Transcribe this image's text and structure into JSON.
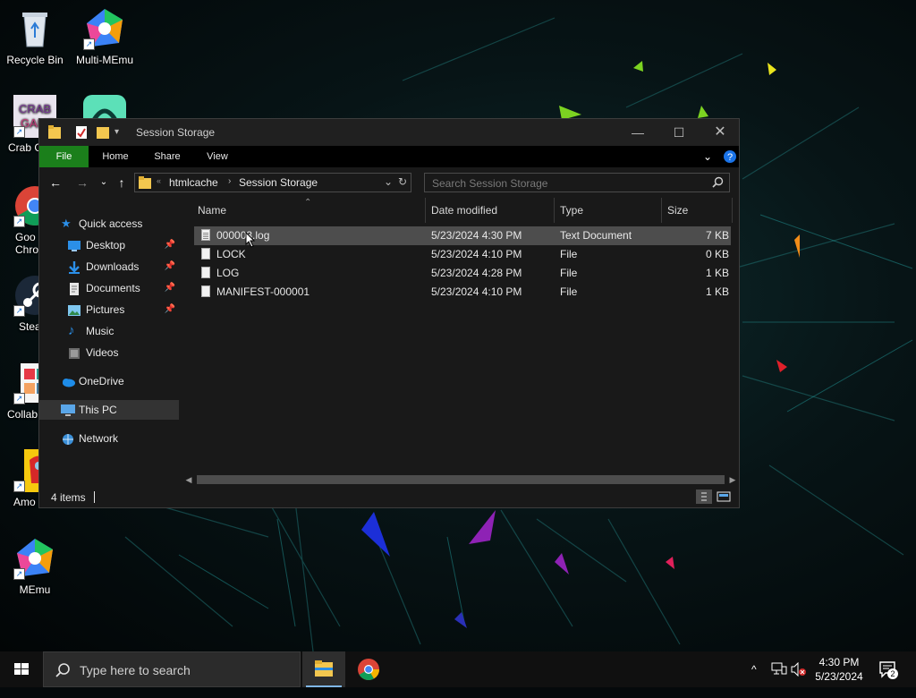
{
  "desktop": {
    "icons": [
      {
        "label": "Recycle Bin"
      },
      {
        "label": "Multi-MEmu"
      },
      {
        "label": "Crab G"
      },
      {
        "label": "Goo\nChro"
      },
      {
        "label": "Stea"
      },
      {
        "label": "Collab"
      },
      {
        "label": "Amo"
      },
      {
        "label": "MEmu"
      }
    ]
  },
  "window": {
    "title": "Session Storage",
    "ribbon_tabs": [
      "File",
      "Home",
      "Share",
      "View"
    ],
    "address": {
      "crumbs": [
        "htmlcache",
        "Session Storage"
      ]
    },
    "search_placeholder": "Search Session Storage",
    "nav": {
      "quick_access": "Quick access",
      "desktop": "Desktop",
      "downloads": "Downloads",
      "documents": "Documents",
      "pictures": "Pictures",
      "music": "Music",
      "videos": "Videos",
      "onedrive": "OneDrive",
      "this_pc": "This PC",
      "network": "Network"
    },
    "columns": {
      "name": "Name",
      "date": "Date modified",
      "type": "Type",
      "size": "Size"
    },
    "files": [
      {
        "name": "000003.log",
        "date": "5/23/2024 4:30 PM",
        "type": "Text Document",
        "size": "7 KB"
      },
      {
        "name": "LOCK",
        "date": "5/23/2024 4:10 PM",
        "type": "File",
        "size": "0 KB"
      },
      {
        "name": "LOG",
        "date": "5/23/2024 4:28 PM",
        "type": "File",
        "size": "1 KB"
      },
      {
        "name": "MANIFEST-000001",
        "date": "5/23/2024 4:10 PM",
        "type": "File",
        "size": "1 KB"
      }
    ],
    "status": "4 items"
  },
  "taskbar": {
    "search_placeholder": "Type here to search",
    "time": "4:30 PM",
    "date": "5/23/2024",
    "notification_count": "2"
  },
  "icons": {
    "start": "windows-logo-icon",
    "search": "magnifier-icon",
    "explorer": "folder-icon",
    "chrome": "chrome-icon"
  },
  "colors": {
    "file_tab": "#1b7f1b",
    "window_bg": "#191919",
    "hover_row": "#4d4d4d",
    "taskbar": "#101010"
  }
}
